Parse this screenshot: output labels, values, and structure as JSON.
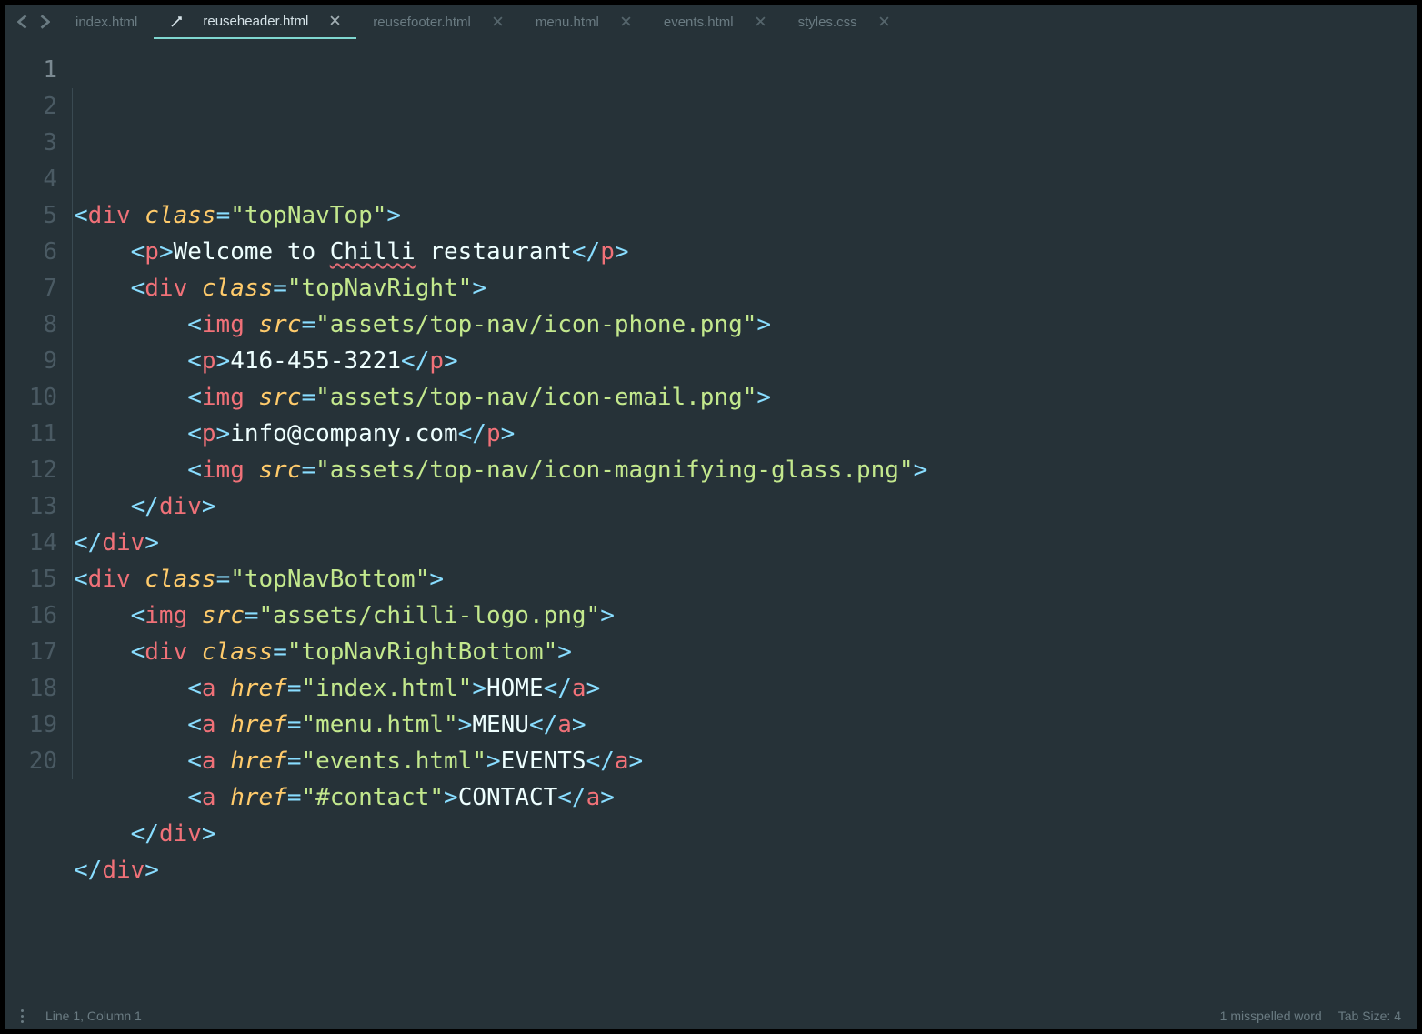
{
  "tabs": [
    {
      "label": "index.html",
      "active": false,
      "dirty": false,
      "closeable": false
    },
    {
      "label": "reuseheader.html",
      "active": true,
      "dirty": true,
      "closeable": true
    },
    {
      "label": "reusefooter.html",
      "active": false,
      "dirty": false,
      "closeable": true
    },
    {
      "label": "menu.html",
      "active": false,
      "dirty": false,
      "closeable": true
    },
    {
      "label": "events.html",
      "active": false,
      "dirty": false,
      "closeable": true
    },
    {
      "label": "styles.css",
      "active": false,
      "dirty": false,
      "closeable": true
    }
  ],
  "gutter": {
    "lines": [
      "1",
      "2",
      "3",
      "4",
      "5",
      "6",
      "7",
      "8",
      "9",
      "10",
      "11",
      "12",
      "13",
      "14",
      "15",
      "16",
      "17",
      "18",
      "19",
      "20"
    ],
    "current": 1
  },
  "code": {
    "lines": [
      [],
      [
        {
          "t": "pun",
          "v": "<"
        },
        {
          "t": "tag",
          "v": "div"
        },
        {
          "t": "txt",
          "v": " "
        },
        {
          "t": "attr",
          "v": "class"
        },
        {
          "t": "pun",
          "v": "="
        },
        {
          "t": "str",
          "v": "\"topNavTop\""
        },
        {
          "t": "pun",
          "v": ">"
        }
      ],
      [
        {
          "t": "txt",
          "v": "    "
        },
        {
          "t": "pun",
          "v": "<"
        },
        {
          "t": "tag",
          "v": "p"
        },
        {
          "t": "pun",
          "v": ">"
        },
        {
          "t": "txt",
          "v": "Welcome to "
        },
        {
          "t": "txt",
          "v": "Chilli",
          "spell": true
        },
        {
          "t": "txt",
          "v": " restaurant"
        },
        {
          "t": "pun",
          "v": "</"
        },
        {
          "t": "tag",
          "v": "p"
        },
        {
          "t": "pun",
          "v": ">"
        }
      ],
      [
        {
          "t": "txt",
          "v": "    "
        },
        {
          "t": "pun",
          "v": "<"
        },
        {
          "t": "tag",
          "v": "div"
        },
        {
          "t": "txt",
          "v": " "
        },
        {
          "t": "attr",
          "v": "class"
        },
        {
          "t": "pun",
          "v": "="
        },
        {
          "t": "str",
          "v": "\"topNavRight\""
        },
        {
          "t": "pun",
          "v": ">"
        }
      ],
      [
        {
          "t": "txt",
          "v": "        "
        },
        {
          "t": "pun",
          "v": "<"
        },
        {
          "t": "tag",
          "v": "img"
        },
        {
          "t": "txt",
          "v": " "
        },
        {
          "t": "attr",
          "v": "src"
        },
        {
          "t": "pun",
          "v": "="
        },
        {
          "t": "str",
          "v": "\"assets/top-nav/icon-phone.png\""
        },
        {
          "t": "pun",
          "v": ">"
        }
      ],
      [
        {
          "t": "txt",
          "v": "        "
        },
        {
          "t": "pun",
          "v": "<"
        },
        {
          "t": "tag",
          "v": "p"
        },
        {
          "t": "pun",
          "v": ">"
        },
        {
          "t": "txt",
          "v": "416-455-3221"
        },
        {
          "t": "pun",
          "v": "</"
        },
        {
          "t": "tag",
          "v": "p"
        },
        {
          "t": "pun",
          "v": ">"
        }
      ],
      [
        {
          "t": "txt",
          "v": "        "
        },
        {
          "t": "pun",
          "v": "<"
        },
        {
          "t": "tag",
          "v": "img"
        },
        {
          "t": "txt",
          "v": " "
        },
        {
          "t": "attr",
          "v": "src"
        },
        {
          "t": "pun",
          "v": "="
        },
        {
          "t": "str",
          "v": "\"assets/top-nav/icon-email.png\""
        },
        {
          "t": "pun",
          "v": ">"
        }
      ],
      [
        {
          "t": "txt",
          "v": "        "
        },
        {
          "t": "pun",
          "v": "<"
        },
        {
          "t": "tag",
          "v": "p"
        },
        {
          "t": "pun",
          "v": ">"
        },
        {
          "t": "txt",
          "v": "info@company.com"
        },
        {
          "t": "pun",
          "v": "</"
        },
        {
          "t": "tag",
          "v": "p"
        },
        {
          "t": "pun",
          "v": ">"
        }
      ],
      [
        {
          "t": "txt",
          "v": "        "
        },
        {
          "t": "pun",
          "v": "<"
        },
        {
          "t": "tag",
          "v": "img"
        },
        {
          "t": "txt",
          "v": " "
        },
        {
          "t": "attr",
          "v": "src"
        },
        {
          "t": "pun",
          "v": "="
        },
        {
          "t": "str",
          "v": "\"assets/top-nav/icon-magnifying-glass.png\""
        },
        {
          "t": "pun",
          "v": ">"
        }
      ],
      [
        {
          "t": "txt",
          "v": "    "
        },
        {
          "t": "pun",
          "v": "</"
        },
        {
          "t": "tag",
          "v": "div"
        },
        {
          "t": "pun",
          "v": ">"
        }
      ],
      [
        {
          "t": "pun",
          "v": "</"
        },
        {
          "t": "tag",
          "v": "div"
        },
        {
          "t": "pun",
          "v": ">"
        }
      ],
      [
        {
          "t": "pun",
          "v": "<"
        },
        {
          "t": "tag",
          "v": "div"
        },
        {
          "t": "txt",
          "v": " "
        },
        {
          "t": "attr",
          "v": "class"
        },
        {
          "t": "pun",
          "v": "="
        },
        {
          "t": "str",
          "v": "\"topNavBottom\""
        },
        {
          "t": "pun",
          "v": ">"
        }
      ],
      [
        {
          "t": "txt",
          "v": "    "
        },
        {
          "t": "pun",
          "v": "<"
        },
        {
          "t": "tag",
          "v": "img"
        },
        {
          "t": "txt",
          "v": " "
        },
        {
          "t": "attr",
          "v": "src"
        },
        {
          "t": "pun",
          "v": "="
        },
        {
          "t": "str",
          "v": "\"assets/chilli-logo.png\""
        },
        {
          "t": "pun",
          "v": ">"
        }
      ],
      [
        {
          "t": "txt",
          "v": "    "
        },
        {
          "t": "pun",
          "v": "<"
        },
        {
          "t": "tag",
          "v": "div"
        },
        {
          "t": "txt",
          "v": " "
        },
        {
          "t": "attr",
          "v": "class"
        },
        {
          "t": "pun",
          "v": "="
        },
        {
          "t": "str",
          "v": "\"topNavRightBottom\""
        },
        {
          "t": "pun",
          "v": ">"
        }
      ],
      [
        {
          "t": "txt",
          "v": "        "
        },
        {
          "t": "pun",
          "v": "<"
        },
        {
          "t": "tag",
          "v": "a"
        },
        {
          "t": "txt",
          "v": " "
        },
        {
          "t": "attr",
          "v": "href"
        },
        {
          "t": "pun",
          "v": "="
        },
        {
          "t": "str",
          "v": "\"index.html\""
        },
        {
          "t": "pun",
          "v": ">"
        },
        {
          "t": "txt",
          "v": "HOME"
        },
        {
          "t": "pun",
          "v": "</"
        },
        {
          "t": "tag",
          "v": "a"
        },
        {
          "t": "pun",
          "v": ">"
        }
      ],
      [
        {
          "t": "txt",
          "v": "        "
        },
        {
          "t": "pun",
          "v": "<"
        },
        {
          "t": "tag",
          "v": "a"
        },
        {
          "t": "txt",
          "v": " "
        },
        {
          "t": "attr",
          "v": "href"
        },
        {
          "t": "pun",
          "v": "="
        },
        {
          "t": "str",
          "v": "\"menu.html\""
        },
        {
          "t": "pun",
          "v": ">"
        },
        {
          "t": "txt",
          "v": "MENU"
        },
        {
          "t": "pun",
          "v": "</"
        },
        {
          "t": "tag",
          "v": "a"
        },
        {
          "t": "pun",
          "v": ">"
        }
      ],
      [
        {
          "t": "txt",
          "v": "        "
        },
        {
          "t": "pun",
          "v": "<"
        },
        {
          "t": "tag",
          "v": "a"
        },
        {
          "t": "txt",
          "v": " "
        },
        {
          "t": "attr",
          "v": "href"
        },
        {
          "t": "pun",
          "v": "="
        },
        {
          "t": "str",
          "v": "\"events.html\""
        },
        {
          "t": "pun",
          "v": ">"
        },
        {
          "t": "txt",
          "v": "EVENTS"
        },
        {
          "t": "pun",
          "v": "</"
        },
        {
          "t": "tag",
          "v": "a"
        },
        {
          "t": "pun",
          "v": ">"
        }
      ],
      [
        {
          "t": "txt",
          "v": "        "
        },
        {
          "t": "pun",
          "v": "<"
        },
        {
          "t": "tag",
          "v": "a"
        },
        {
          "t": "txt",
          "v": " "
        },
        {
          "t": "attr",
          "v": "href"
        },
        {
          "t": "pun",
          "v": "="
        },
        {
          "t": "str",
          "v": "\"#contact\""
        },
        {
          "t": "pun",
          "v": ">"
        },
        {
          "t": "txt",
          "v": "CONTACT"
        },
        {
          "t": "pun",
          "v": "</"
        },
        {
          "t": "tag",
          "v": "a"
        },
        {
          "t": "pun",
          "v": ">"
        }
      ],
      [
        {
          "t": "txt",
          "v": "    "
        },
        {
          "t": "pun",
          "v": "</"
        },
        {
          "t": "tag",
          "v": "div"
        },
        {
          "t": "pun",
          "v": ">"
        }
      ],
      [
        {
          "t": "pun",
          "v": "</"
        },
        {
          "t": "tag",
          "v": "div"
        },
        {
          "t": "pun",
          "v": ">"
        }
      ]
    ]
  },
  "status": {
    "cursor": "Line 1, Column 1",
    "spell": "1 misspelled word",
    "tab": "Tab Size: 4"
  }
}
